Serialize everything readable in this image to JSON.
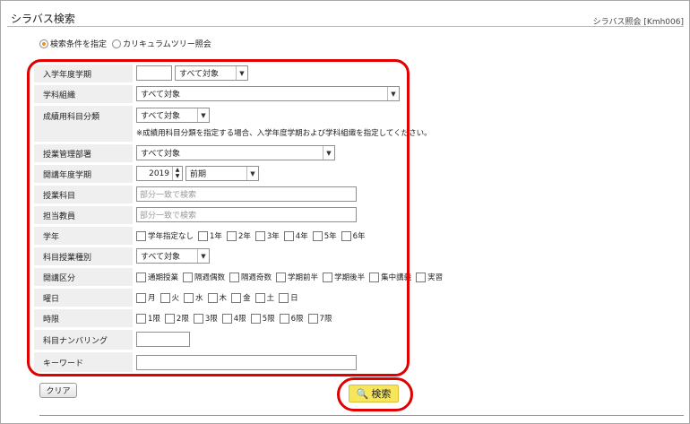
{
  "header": {
    "title": "シラバス検索",
    "screen_id": "シラバス照会 [Kmh006]"
  },
  "mode": {
    "options": [
      {
        "label": "検索条件を指定",
        "checked": true
      },
      {
        "label": "カリキュラムツリー照会",
        "checked": false
      }
    ]
  },
  "form": {
    "year_term": {
      "label": "入学年度学期",
      "value": "",
      "select": "すべて対象"
    },
    "department": {
      "label": "学科組織",
      "select": "すべて対象"
    },
    "grade_category": {
      "label": "成績用科目分類",
      "select": "すべて対象",
      "note": "※成績用科目分類を指定する場合、入学年度学期および学科組織を指定してください。"
    },
    "managing_dept": {
      "label": "授業管理部署",
      "select": "すべて対象"
    },
    "opening_term": {
      "label": "開講年度学期",
      "year": "2019",
      "term": "前期"
    },
    "subject": {
      "label": "授業科目",
      "placeholder": "部分一致で検索"
    },
    "teacher": {
      "label": "担当教員",
      "placeholder": "部分一致で検索"
    },
    "grade": {
      "label": "学年",
      "options": [
        "学年指定なし",
        "1年",
        "2年",
        "3年",
        "4年",
        "5年",
        "6年"
      ]
    },
    "class_type": {
      "label": "科目授業種別",
      "select": "すべて対象"
    },
    "course_div": {
      "label": "開講区分",
      "options": [
        "通期授業",
        "隔週偶数",
        "隔週奇数",
        "学期前半",
        "学期後半",
        "集中講義",
        "実習"
      ]
    },
    "weekday": {
      "label": "曜日",
      "options": [
        "月",
        "火",
        "水",
        "木",
        "金",
        "土",
        "日"
      ]
    },
    "period": {
      "label": "時限",
      "options": [
        "1限",
        "2限",
        "3限",
        "4限",
        "5限",
        "6限",
        "7限"
      ]
    },
    "numbering": {
      "label": "科目ナンバリング",
      "value": ""
    },
    "keyword": {
      "label": "キーワード",
      "value": ""
    }
  },
  "buttons": {
    "clear": "クリア",
    "search": "検索"
  }
}
